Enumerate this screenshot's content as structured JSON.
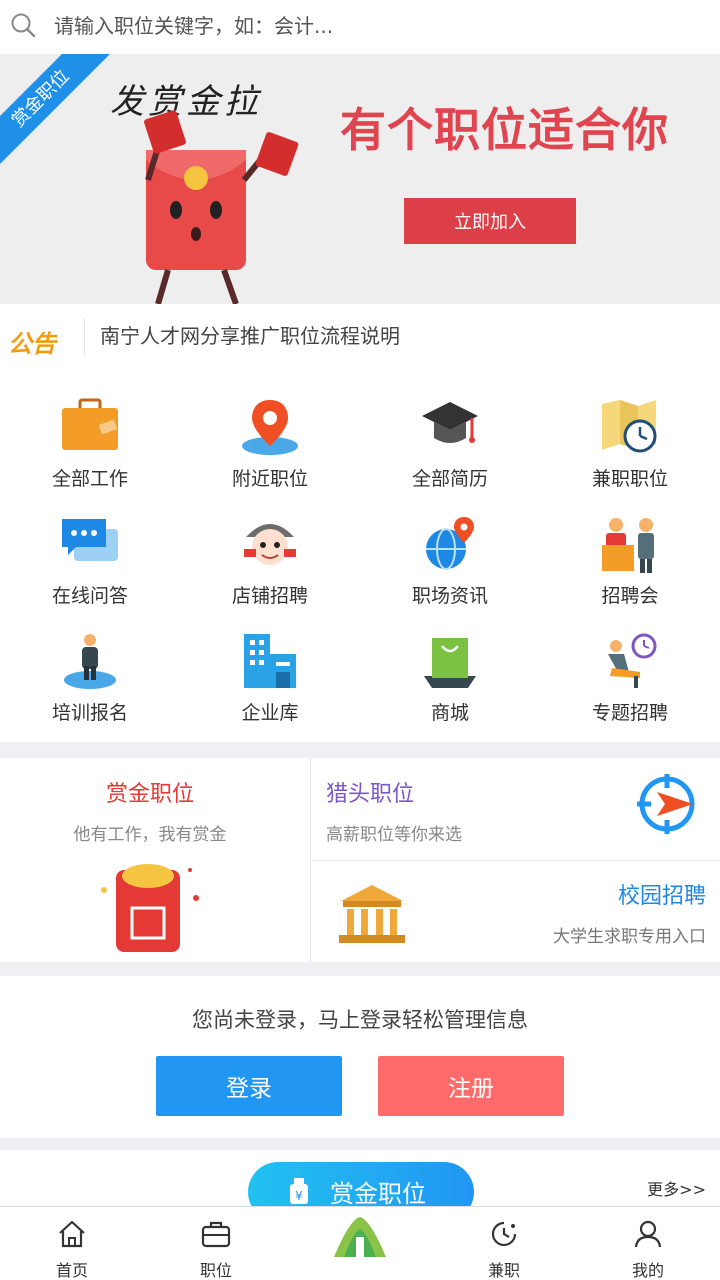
{
  "search": {
    "placeholder": "请输入职位关键字，如：会计..."
  },
  "banner": {
    "ribbon": "赏金职位",
    "handwriting": "发赏金拉",
    "headline": "有个职位适合你",
    "join_label": "立即加入",
    "colors": {
      "headline": "#e0454f",
      "button": "#dc3f48",
      "ribbon": "#1e90e8"
    }
  },
  "notice": {
    "badge": "公告",
    "text": "南宁人才网分享推广职位流程说明"
  },
  "grid": [
    {
      "label": "全部工作",
      "icon": "briefcase-icon"
    },
    {
      "label": "附近职位",
      "icon": "location-pin-icon"
    },
    {
      "label": "全部简历",
      "icon": "graduation-cap-icon"
    },
    {
      "label": "兼职职位",
      "icon": "map-clock-icon"
    },
    {
      "label": "在线问答",
      "icon": "chat-bubble-icon"
    },
    {
      "label": "店铺招聘",
      "icon": "mascot-icon"
    },
    {
      "label": "职场资讯",
      "icon": "globe-pin-icon"
    },
    {
      "label": "招聘会",
      "icon": "interview-icon"
    },
    {
      "label": "培训报名",
      "icon": "person-podium-icon"
    },
    {
      "label": "企业库",
      "icon": "buildings-icon"
    },
    {
      "label": "商城",
      "icon": "shopping-bag-icon"
    },
    {
      "label": "专题招聘",
      "icon": "person-clock-icon"
    }
  ],
  "feature": {
    "bounty": {
      "title": "赏金职位",
      "subtitle": "他有工作，我有赏金"
    },
    "headhunter": {
      "title": "猎头职位",
      "subtitle": "高薪职位等你来选"
    },
    "campus": {
      "title": "校园招聘",
      "subtitle": "大学生求职专用入口"
    }
  },
  "login": {
    "prompt": "您尚未登录，马上登录轻松管理信息",
    "login_label": "登录",
    "register_label": "注册"
  },
  "bounty_strip": {
    "title": "赏金职位",
    "more": "更多>>"
  },
  "tabbar": [
    {
      "label": "首页",
      "icon": "home-icon"
    },
    {
      "label": "职位",
      "icon": "briefcase-outline-icon"
    },
    {
      "label": "",
      "icon": "site-logo-icon"
    },
    {
      "label": "兼职",
      "icon": "clock-icon"
    },
    {
      "label": "我的",
      "icon": "user-icon"
    }
  ]
}
